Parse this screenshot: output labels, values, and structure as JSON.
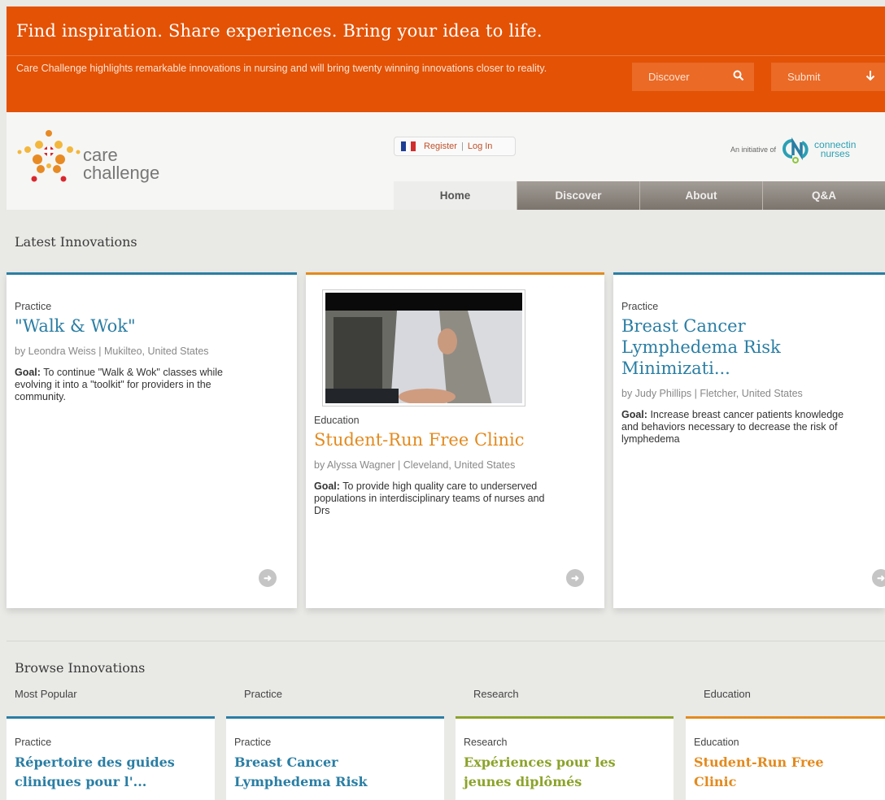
{
  "banner": {
    "headline": "Find inspiration. Share experiences. Bring your idea to life.",
    "subtext": "Care Challenge highlights remarkable innovations in nursing and will bring twenty winning innovations closer to reality.",
    "discover_label": "Discover",
    "submit_label": "Submit"
  },
  "header": {
    "logo_line1": "care",
    "logo_line2": "challenge",
    "register_label": "Register",
    "login_label": "Log In",
    "initiative_label": "An initiative of",
    "partner_line1": "connectin",
    "partner_line2": "nurses"
  },
  "nav": {
    "tabs": [
      {
        "label": "Home"
      },
      {
        "label": "Discover"
      },
      {
        "label": "About"
      },
      {
        "label": "Q&A"
      }
    ]
  },
  "latest": {
    "title": "Latest Innovations",
    "cards": [
      {
        "category": "Practice",
        "title": "\"Walk & Wok\"",
        "byline": "by Leondra Weiss | Mukilteo, United States",
        "goal_label": "Goal:",
        "goal": "To continue \"Walk & Wok\" classes while evolving it into a \"toolkit\" for providers in the community."
      },
      {
        "category": "Education",
        "title": "Student-Run Free Clinic",
        "byline": "by Alyssa Wagner | Cleveland, United States",
        "goal_label": "Goal:",
        "goal": "To provide high quality care to underserved populations in interdisciplinary teams of nurses and Drs"
      },
      {
        "category": "Practice",
        "title": "Breast Cancer Lymphedema Risk Minimizati...",
        "byline": "by Judy Phillips | Fletcher, United States",
        "goal_label": "Goal:",
        "goal": "Increase breast cancer patients knowledge and behaviors necessary to decrease the risk of lymphedema"
      }
    ]
  },
  "browse": {
    "title": "Browse Innovations",
    "columns": [
      {
        "label": "Most Popular",
        "category": "Practice",
        "title": "Répertoire des guides cliniques pour l'..."
      },
      {
        "label": "Practice",
        "category": "Practice",
        "title": "Breast Cancer Lymphedema Risk"
      },
      {
        "label": "Research",
        "category": "Research",
        "title": "Expériences pour les jeunes diplômés"
      },
      {
        "label": "Education",
        "category": "Education",
        "title": "Student-Run Free Clinic"
      }
    ]
  },
  "colors": {
    "banner": "#e35205",
    "practice": "#2a7ea4",
    "education": "#e38a1e",
    "research": "#8ba32a"
  },
  "icons": [
    "search-icon",
    "down-arrow-icon",
    "french-flag-icon",
    "arrow-right-icon"
  ]
}
